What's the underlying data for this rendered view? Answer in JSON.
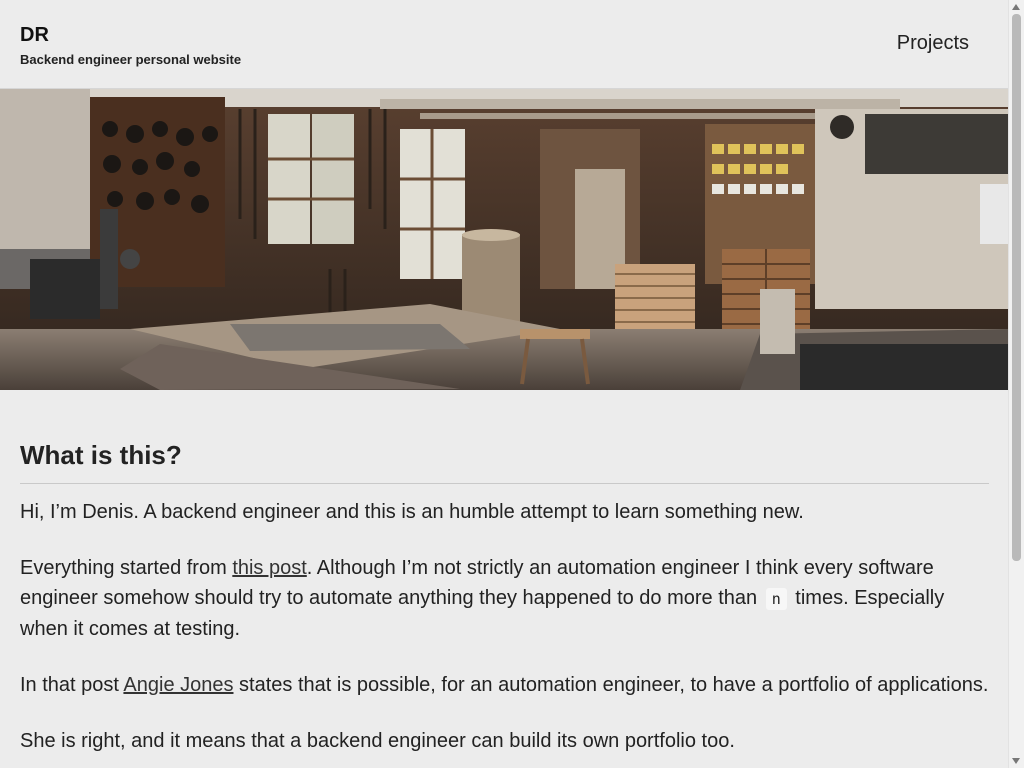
{
  "site": {
    "name": "DR",
    "tagline": "Backend engineer personal website"
  },
  "nav": {
    "projects_label": "Projects"
  },
  "hero": {
    "alt": "Woodworking workshop"
  },
  "article": {
    "title": "What is this?",
    "p1": "Hi, I’m Denis. A backend engineer and this is an humble attempt to learn something new.",
    "p2_before": "Everything started from ",
    "p2_link": "this post",
    "p2_middle": ". Although I’m not strictly an automation engineer I think every software engineer somehow should try to automate anything they happened to do more than ",
    "p2_code": "n",
    "p2_after": " times. Especially when it comes at testing.",
    "p3_before": "In that post ",
    "p3_link": "Angie Jones",
    "p3_after": " states that is possible, for an automation engineer, to have a portfolio of applications.",
    "p4": "She is right, and it means that a backend engineer can build its own portfolio too."
  }
}
